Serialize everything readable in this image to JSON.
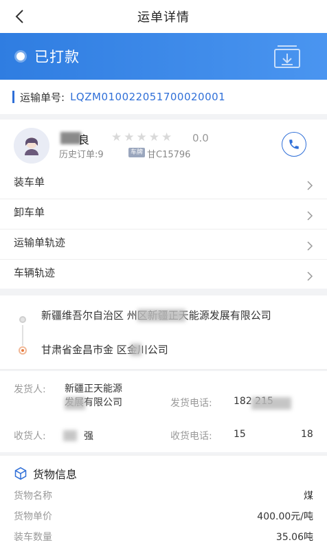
{
  "nav": {
    "title": "运单详情"
  },
  "status": {
    "text": "已打款",
    "accent": "#2f7de1"
  },
  "waybill": {
    "label": "运输单号:",
    "number": "LQZM010022051700020001"
  },
  "driver": {
    "name_visible": "良",
    "rating": "0.0",
    "stars_total": 5,
    "stars_filled": 0,
    "history": "历史订单:9",
    "plate_tag": "车牌",
    "plate": "甘C15796"
  },
  "menu": [
    {
      "label": "装车单"
    },
    {
      "label": "卸车单"
    },
    {
      "label": "运输单轨迹"
    },
    {
      "label": "车辆轨迹"
    }
  ],
  "route": {
    "from": "新疆维吾尔自治区        州区新疆正天能源发展有限公司",
    "to": "甘肃省金昌市金  区金川公司"
  },
  "party": {
    "shipper_label": "发货人:",
    "shipper_value": "新疆正天能源发展有限公司",
    "shipper_phone_label": "发货电话:",
    "shipper_phone": "182        215",
    "receiver_label": "收货人:",
    "receiver_value": "强",
    "receiver_phone_label": "收货电话:",
    "receiver_phone_a": "15",
    "receiver_phone_b": "18"
  },
  "cargo": {
    "title": "货物信息",
    "rows": [
      {
        "label": "货物名称",
        "value": "煤"
      },
      {
        "label": "货物单价",
        "value": "400.00元/吨"
      },
      {
        "label": "装车数量",
        "value": "35.06吨"
      }
    ]
  }
}
